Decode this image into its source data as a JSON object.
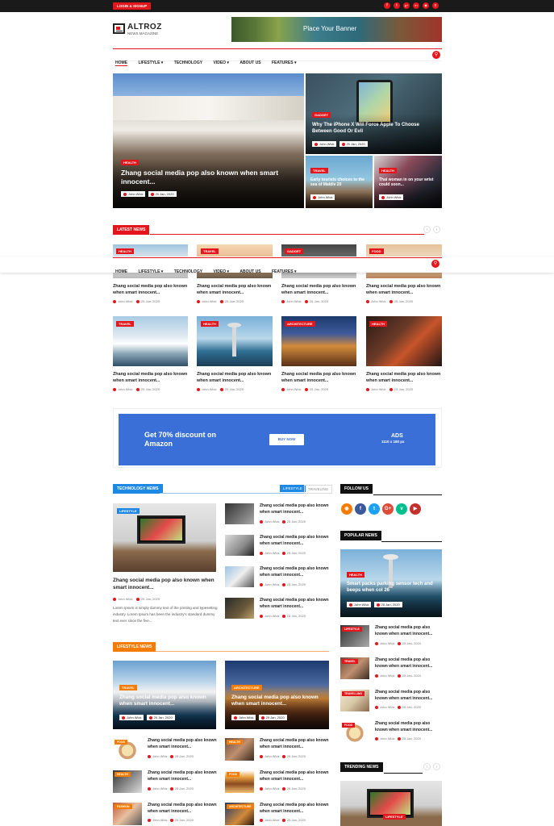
{
  "topbar": {
    "login": "LOGIN & SIGNUP"
  },
  "brand": {
    "name": "ALTROZ",
    "tagline": "NEWS MAGAZINE"
  },
  "banner": {
    "text": "Place Your Banner"
  },
  "nav": {
    "home": "HOME",
    "lifestyle": "LIFESTYLE",
    "technology": "TECHNOLOGY",
    "video": "VIDEO",
    "about": "ABOUT US",
    "features": "FEATURES"
  },
  "hero": {
    "main": {
      "tag": "HEALTH",
      "title": "Zhang social media pop also known when smart innocent...",
      "author": "John Wick",
      "date": "20 Jan, 2020"
    },
    "top_right": {
      "tag": "GADGET",
      "title": "Why The iPhone X Will Force Apple To Choose Between Good Or Evil",
      "author": "John Wick",
      "date": "20 Jan, 2020"
    },
    "bottom_left": {
      "tag": "TRAVEL",
      "title": "Early tourists choices to the sea of Maldiv 20",
      "author": "John Wick"
    },
    "bottom_right": {
      "tag": "HEALTH",
      "title": "Thai woman in on your wrist could soon...",
      "author": "John Wick"
    }
  },
  "latest": {
    "heading": "LATEST NEWS",
    "row1": [
      {
        "tag": "HEALTH",
        "title": "Zhang social media pop also known when smart innocent...",
        "author": "John Wick",
        "date": "25 Jan, 2020"
      },
      {
        "tag": "TRAVEL",
        "title": "Zhang social media pop also known when smart innocent...",
        "author": "John Wick",
        "date": "25 Jan, 2020"
      },
      {
        "tag": "GADGET",
        "title": "Zhang social media pop also known when smart innocent...",
        "author": "John Wick",
        "date": "25 Jan, 2020"
      },
      {
        "tag": "FOOD",
        "title": "Zhang social media pop also known when smart innocent...",
        "author": "John Wick",
        "date": "25 Jan, 2020"
      }
    ],
    "row2": [
      {
        "tag": "TRAVEL",
        "title": "Zhang social media pop also known when smart innocent...",
        "author": "John Wick",
        "date": "25 Jan, 2020"
      },
      {
        "tag": "HEALTH",
        "title": "Zhang social media pop also known when smart innocent...",
        "author": "John Wick",
        "date": "25 Jan, 2020"
      },
      {
        "tag": "ARCHITECTURE",
        "title": "Zhang social media pop also known when smart innocent...",
        "author": "John Wick",
        "date": "25 Jan, 2020"
      },
      {
        "tag": "HEALTH",
        "title": "Zhang social media pop also known when smart innocent...",
        "author": "John Wick",
        "date": "25 Jan, 2020"
      }
    ]
  },
  "ad": {
    "headline": "Get 70% discount on Amazon",
    "button": "BUY NOW",
    "label": "ADS",
    "size": "1110 x 180 px"
  },
  "tech": {
    "heading": "TECHNOLOGY NEWS",
    "tab1": "LIFESTYLE",
    "tab2": "TRAVELING",
    "feature": {
      "tag": "LIFESTYLE",
      "title": "Zhang social media pop also known when smart innocent...",
      "author": "John Wick",
      "date": "25 Jan, 2020",
      "excerpt": "Lorem Ipsum is simply dummy text of the printing and typesetting industry. Lorem Ipsum has been the industry's standard dummy text ever since the five..."
    },
    "list": [
      {
        "title": "Zhang social media pop also known when smart innocent...",
        "author": "John Wick",
        "date": "25 Jan, 2020"
      },
      {
        "title": "Zhang social media pop also known when smart innocent...",
        "author": "John Wick",
        "date": "25 Jan, 2020"
      },
      {
        "title": "Zhang social media pop also known when smart innocent...",
        "author": "John Wick",
        "date": "25 Jan, 2020"
      },
      {
        "title": "Zhang social media pop also known when smart innocent...",
        "author": "John Wick",
        "date": "25 Jan, 2020"
      }
    ]
  },
  "lifestyle": {
    "heading": "LIFESTYLE NEWS",
    "big": [
      {
        "tag": "TRAVEL",
        "title": "Zhang social media pop also known when smart innocent...",
        "author": "John Wick",
        "date": "25 Jan, 2020"
      },
      {
        "tag": "ARCHITECTURE",
        "title": "Zhang social media pop also known when smart innocent...",
        "author": "John Wick",
        "date": "25 Jan, 2020"
      }
    ],
    "small": [
      {
        "tag": "FOOD",
        "title": "Zhang social media pop also known when smart innocent...",
        "author": "John Wick",
        "date": "25 Jan, 2020"
      },
      {
        "tag": "HEALTH",
        "title": "Zhang social media pop also known when smart innocent...",
        "author": "John Wick",
        "date": "25 Jan, 2020"
      },
      {
        "tag": "HEALTH",
        "title": "Zhang social media pop also known when smart innocent...",
        "author": "John Wick",
        "date": "25 Jan, 2020"
      },
      {
        "tag": "FOOD",
        "title": "Zhang social media pop also known when smart innocent...",
        "author": "John Wick",
        "date": "25 Jan, 2020"
      },
      {
        "tag": "FASHION",
        "title": "Zhang social media pop also known when smart innocent...",
        "author": "John Wick",
        "date": "25 Jan, 2020"
      },
      {
        "tag": "ARCHITECTURE",
        "title": "Zhang social media pop also known when smart innocent...",
        "author": "John Wick",
        "date": "25 Jan, 2020"
      }
    ]
  },
  "sidebar": {
    "follow": "FOLLOW US",
    "popular": "POPULAR NEWS",
    "popular_feature": {
      "tag": "HEALTH",
      "title": "Smart packs parking sensor tech and beeps when col 26",
      "author": "John Wick",
      "date": "25 Jan, 2020"
    },
    "popular_list": [
      {
        "tag": "LIFESTYLE",
        "title": "Zhang social media pop also known when smart innocent...",
        "author": "John Wick",
        "date": "25 Jan, 2020"
      },
      {
        "tag": "TRAVEL",
        "title": "Zhang social media pop also known when smart innocent...",
        "author": "John Wick",
        "date": "25 Jan, 2020"
      },
      {
        "tag": "TRAVELLING",
        "title": "Zhang social media pop also known when smart innocent...",
        "author": "John Wick",
        "date": "25 Jan, 2020"
      },
      {
        "tag": "FOOD",
        "title": "Zhang social media pop also known when smart innocent...",
        "author": "John Wick",
        "date": "25 Jan, 2020"
      }
    ],
    "trending": "TRENDING NEWS",
    "trending_tag": "LIFESTYLE"
  },
  "colors": {
    "accent": "#e4161b",
    "blue": "#1e88e5",
    "orange": "#f57c00",
    "dark": "#111111"
  }
}
